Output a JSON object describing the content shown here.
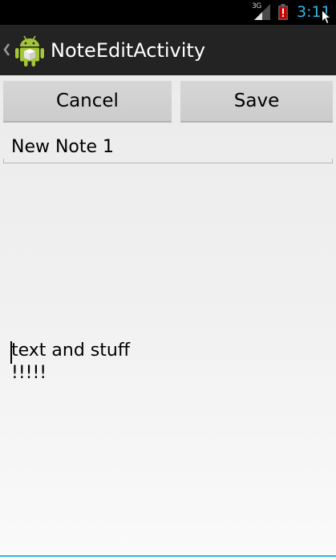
{
  "status_bar": {
    "network_type": "3G",
    "time": "3:11"
  },
  "action_bar": {
    "title": "NoteEditActivity"
  },
  "buttons": {
    "cancel_label": "Cancel",
    "save_label": "Save"
  },
  "note": {
    "title_value": "New Note 1",
    "body_lines": [
      "text and stuff",
      "!!!!!"
    ]
  },
  "colors": {
    "accent": "#33b5e5",
    "status_bar_bg": "#000000",
    "action_bar_bg": "#232323",
    "battery_alert": "#cc0000",
    "android_green": "#a4c639"
  }
}
